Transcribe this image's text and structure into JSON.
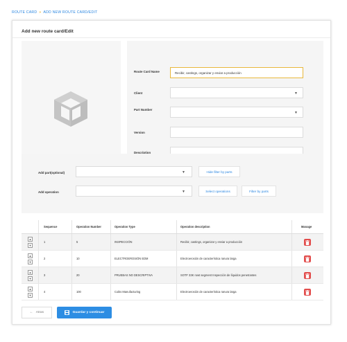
{
  "breadcrumb": {
    "items": [
      "ROUTE CARD",
      "ADD NEW ROUTE CARD/EDIT"
    ],
    "separator": "»"
  },
  "card": {
    "title": "Add new route card/Edit"
  },
  "form": {
    "route_card_name": {
      "label": "Route Card Name",
      "value": "Recibir, castings, organizar y enviar a producción"
    },
    "client": {
      "label": "Client",
      "value": ""
    },
    "part_number": {
      "label": "Part Number",
      "value": ""
    },
    "version": {
      "label": "Version",
      "value": ""
    },
    "description": {
      "label": "Description",
      "value": ""
    }
  },
  "filters": {
    "add_part": {
      "label": "Add part(optional)",
      "value": ""
    },
    "add_operation": {
      "label": "Add operation",
      "value": ""
    },
    "hide_filter_parts": "Hide filter by parts",
    "select_operations": "Select operations",
    "filter_parts": "Filter by parts"
  },
  "table": {
    "headers": [
      "Sequence",
      "Operation Number",
      "Operation Type",
      "Operation description",
      "Manage"
    ],
    "rows": [
      {
        "sequence": "1",
        "op_number": "5",
        "op_type": "INSPECCIÓN",
        "op_description": "Recibir, castings, organizar y enviar a producción"
      },
      {
        "sequence": "2",
        "op_number": "10",
        "op_type": "ELECTROEROSIÓN EDM",
        "op_description": "Electroerosión de característica ranura larga"
      },
      {
        "sequence": "3",
        "op_number": "20",
        "op_type": "PRUEBAS NO DESCRIPTIVA",
        "op_description": "SOTF 33K rowt segment Inspección de líquidos penetrantes"
      },
      {
        "sequence": "4",
        "op_number": "100",
        "op_type": "Coiks Manufacturing",
        "op_description": "Electroerosión de característica ranura larga"
      }
    ]
  },
  "actions": {
    "back": "Atras",
    "save": "Guardar y continuar"
  },
  "icons": {
    "placeholder": "cube-icon",
    "delete": "trash-icon",
    "save": "floppy-icon",
    "back": "arrow-left-icon",
    "dropdown": "chevron-down-icon"
  },
  "colors": {
    "accent": "#2d8de3",
    "danger": "#e24c4b",
    "focus": "#e8b73a",
    "breadcrumb_sep": "#e0a200"
  }
}
